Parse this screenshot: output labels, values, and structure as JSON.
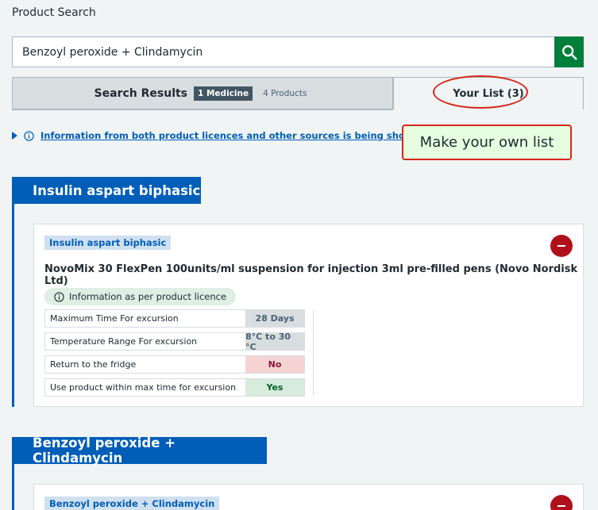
{
  "page": {
    "title": "Product Search"
  },
  "search": {
    "value": "Benzoyl peroxide + Clindamycin"
  },
  "tabs": {
    "results": {
      "label": "Search Results",
      "medicine_badge": "1 Medicine",
      "products_badge": "4 Products"
    },
    "list": {
      "label": "Your List (3)"
    }
  },
  "info": {
    "link_text": "Information from both product licences and other sources is being shown"
  },
  "annotation": {
    "callout": "Make your own list"
  },
  "sections": [
    {
      "heading": "Insulin aspart biphasic",
      "card": {
        "tag": "Insulin aspart biphasic",
        "product": "NovoMix 30 FlexPen 100units/ml suspension for injection 3ml pre-filled pens (Novo Nordisk Ltd)",
        "licence_note": "Information as per product licence",
        "rows": [
          {
            "label": "Maximum Time For excursion",
            "value": "28 Days"
          },
          {
            "label": "Temperature Range For excursion",
            "value": "8°C to 30 °C"
          },
          {
            "label": "Return to the fridge",
            "value": "No"
          },
          {
            "label": "Use product within max time for excursion",
            "value": "Yes"
          }
        ]
      }
    },
    {
      "heading": "Benzoyl peroxide + Clindamycin",
      "card": {
        "tag": "Benzoyl peroxide + Clindamycin"
      }
    }
  ],
  "colors": {
    "nhs_blue": "#005eb8",
    "search_green": "#007f3b",
    "remove_red": "#b0101c",
    "annotation_red": "#d5281b"
  }
}
